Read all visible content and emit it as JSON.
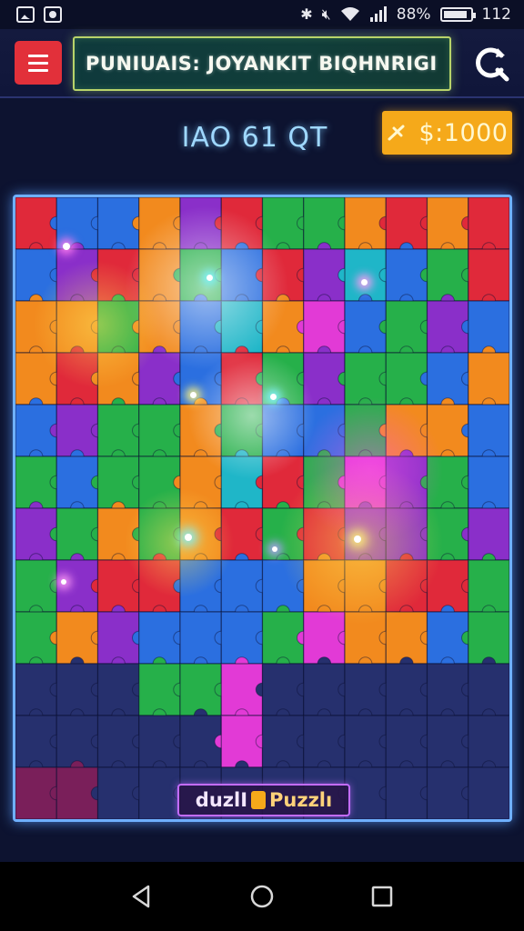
{
  "status_bar": {
    "battery_percent": "88%",
    "battery_level": 0.88,
    "time": "112",
    "icons": [
      "image-icon",
      "record-icon",
      "bluetooth-icon",
      "mute-icon",
      "wifi-icon",
      "signal-icon",
      "battery-icon"
    ]
  },
  "header": {
    "title": "PUNIUAIS: JOYANKIT BIQHNRIGI",
    "menu_icon": "hamburger-icon",
    "refresh_icon": "refresh-icon"
  },
  "score": {
    "label": "IAO 61 QT",
    "coins": "$:1000",
    "coin_icon": "coin-icon"
  },
  "board": {
    "brand_part1": "duzlI",
    "brand_part2": "Puzzlı",
    "rows": 12,
    "cols": 12,
    "colors": {
      "red": "#e0293a",
      "blue": "#2b6fe0",
      "green": "#26b04a",
      "orange": "#f28a1e",
      "purple": "#8a2fc9",
      "magenta": "#e23ad6",
      "teal": "#1fb6c8",
      "navy": "#26306e",
      "dark": "#1e2660",
      "wine": "#7a1f5a"
    },
    "pieces": [
      [
        "red",
        "blue",
        "blue",
        "orange",
        "purple",
        "red",
        "green",
        "green",
        "orange",
        "red",
        "orange",
        "red"
      ],
      [
        "blue",
        "purple",
        "red",
        "orange",
        "green",
        "blue",
        "red",
        "purple",
        "teal",
        "blue",
        "green",
        "red"
      ],
      [
        "orange",
        "orange",
        "green",
        "orange",
        "blue",
        "teal",
        "orange",
        "magenta",
        "blue",
        "green",
        "purple",
        "blue"
      ],
      [
        "orange",
        "red",
        "orange",
        "purple",
        "blue",
        "red",
        "green",
        "purple",
        "green",
        "green",
        "blue",
        "orange"
      ],
      [
        "blue",
        "purple",
        "green",
        "green",
        "orange",
        "green",
        "blue",
        "blue",
        "green",
        "orange",
        "orange",
        "blue"
      ],
      [
        "green",
        "blue",
        "green",
        "green",
        "orange",
        "teal",
        "red",
        "green",
        "magenta",
        "purple",
        "green",
        "blue"
      ],
      [
        "purple",
        "green",
        "orange",
        "green",
        "orange",
        "red",
        "green",
        "red",
        "purple",
        "purple",
        "green",
        "purple"
      ],
      [
        "green",
        "purple",
        "red",
        "red",
        "blue",
        "blue",
        "blue",
        "orange",
        "orange",
        "red",
        "red",
        "green"
      ],
      [
        "green",
        "orange",
        "purple",
        "blue",
        "blue",
        "blue",
        "green",
        "magenta",
        "orange",
        "orange",
        "blue",
        "green"
      ],
      [
        "navy",
        "navy",
        "navy",
        "green",
        "green",
        "magenta",
        "navy",
        "navy",
        "navy",
        "navy",
        "navy",
        "navy"
      ],
      [
        "navy",
        "navy",
        "navy",
        "navy",
        "navy",
        "magenta",
        "navy",
        "navy",
        "navy",
        "navy",
        "navy",
        "navy"
      ],
      [
        "wine",
        "wine",
        "navy",
        "navy",
        "navy",
        "navy",
        "navy",
        "navy",
        "navy",
        "navy",
        "navy",
        "navy"
      ]
    ]
  },
  "nav": {
    "back_icon": "back-icon",
    "home_icon": "home-icon",
    "recents_icon": "recents-icon"
  }
}
